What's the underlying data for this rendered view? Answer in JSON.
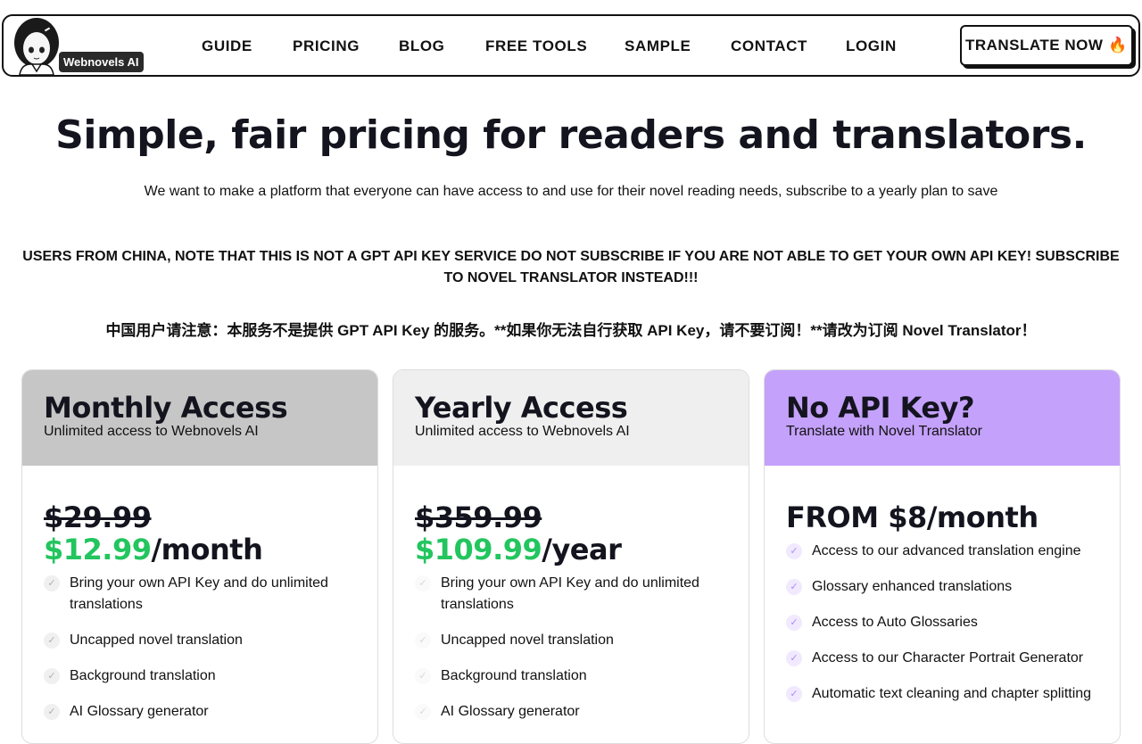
{
  "header": {
    "logo_badge": "Webnovels AI",
    "nav": [
      "GUIDE",
      "PRICING",
      "BLOG",
      "FREE TOOLS",
      "SAMPLE",
      "CONTACT",
      "LOGIN"
    ],
    "cta_label": "TRANSLATE NOW",
    "cta_icon": "🔥"
  },
  "hero": {
    "title": "Simple, fair pricing for readers and translators.",
    "subtitle": "We want to make a platform that everyone can have access to and use for their novel reading needs, subscribe to a yearly plan to save",
    "warning_en": "USERS FROM CHINA, NOTE THAT THIS IS NOT A GPT API KEY SERVICE DO NOT SUBSCRIBE IF YOU ARE NOT ABLE TO GET YOUR OWN API KEY! SUBSCRIBE TO NOVEL TRANSLATOR INSTEAD!!!",
    "warning_cn": "中国用户请注意：本服务不是提供 GPT API Key 的服务。**如果你无法自行获取 API Key，请不要订阅！**请改为订阅 Novel Translator！"
  },
  "plans": [
    {
      "title": "Monthly Access",
      "subtitle": "Unlimited access to Webnovels AI",
      "header_color": "#c6c6c6",
      "old_price": "$29.99",
      "new_price": "$12.99",
      "period": "/month",
      "features": [
        "Bring your own API Key and do unlimited translations",
        "Uncapped novel translation",
        "Background translation",
        "AI Glossary generator"
      ]
    },
    {
      "title": "Yearly Access",
      "subtitle": "Unlimited access to Webnovels AI",
      "header_color": "#efefef",
      "old_price": "$359.99",
      "new_price": "$109.99",
      "period": "/year",
      "features": [
        "Bring your own API Key and do unlimited translations",
        "Uncapped novel translation",
        "Background translation",
        "AI Glossary generator"
      ]
    },
    {
      "title": "No API Key?",
      "subtitle": "Translate with Novel Translator",
      "header_color": "#c4a1fb",
      "price": "FROM $8/month",
      "features": [
        "Access to our advanced translation engine",
        "Glossary enhanced translations",
        "Access to Auto Glossaries",
        "Access to our Character Portrait Generator",
        "Automatic text cleaning and chapter splitting"
      ]
    }
  ]
}
